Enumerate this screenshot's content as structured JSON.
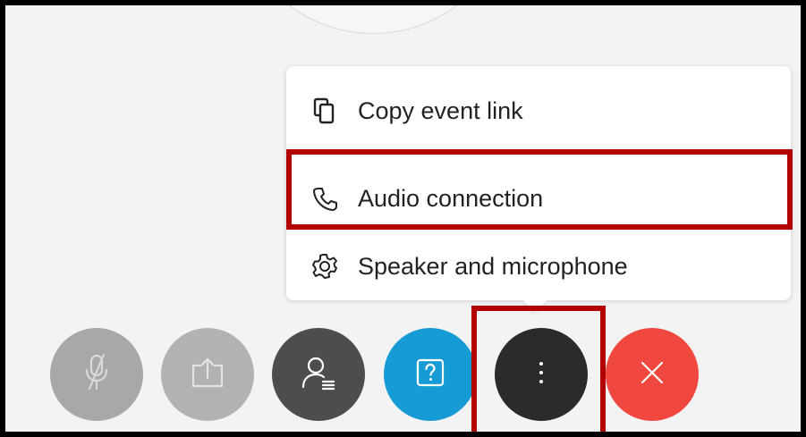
{
  "menu": {
    "items": [
      {
        "label": "Copy event link",
        "icon": "copy-icon"
      },
      {
        "label": "Audio connection",
        "icon": "phone-icon",
        "highlighted": true
      },
      {
        "label": "Speaker and microphone",
        "icon": "gear-icon"
      }
    ]
  },
  "controls": [
    {
      "name": "mute",
      "icon": "microphone-muted-icon",
      "color": "#a8a8a8",
      "enabled": false
    },
    {
      "name": "share",
      "icon": "share-icon",
      "color": "#b2b2b2",
      "enabled": false
    },
    {
      "name": "participants",
      "icon": "participants-icon",
      "color": "#4d4d4d"
    },
    {
      "name": "qa",
      "icon": "question-icon",
      "color": "#169bd5"
    },
    {
      "name": "more",
      "icon": "more-options-icon",
      "color": "#2b2b2b",
      "highlighted": true
    },
    {
      "name": "leave",
      "icon": "close-icon",
      "color": "#f0473f"
    }
  ],
  "colors": {
    "highlight": "#b30000",
    "frame": "#000000",
    "background": "#f3f3f3"
  }
}
